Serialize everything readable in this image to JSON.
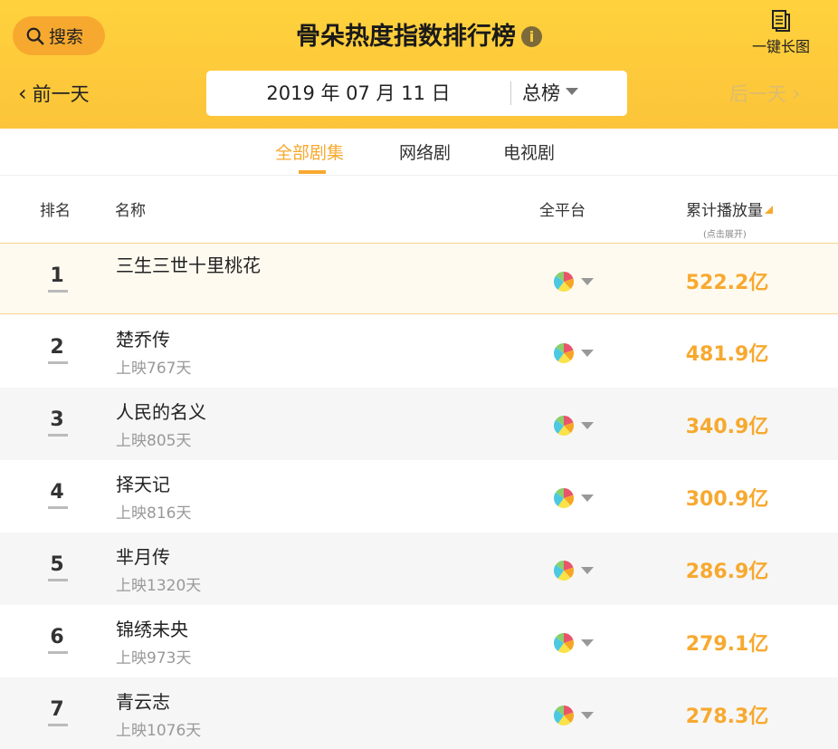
{
  "header": {
    "search_label": "搜索",
    "title": "骨朵热度指数排行榜",
    "info_glyph": "i",
    "long_image_label": "一键长图",
    "prev_day": "前一天",
    "next_day": "后一天",
    "date": "2019 年 07 月 11 日",
    "board": "总榜"
  },
  "tabs": [
    {
      "label": "全部剧集",
      "active": true
    },
    {
      "label": "网络剧",
      "active": false
    },
    {
      "label": "电视剧",
      "active": false
    }
  ],
  "columns": {
    "rank": "排名",
    "name": "名称",
    "platform": "全平台",
    "plays": "累计播放量",
    "plays_hint": "(点击展开)"
  },
  "rows": [
    {
      "rank": "1",
      "name": "三生三世十里桃花",
      "days": "",
      "value": "522.2亿"
    },
    {
      "rank": "2",
      "name": "楚乔传",
      "days": "上映767天",
      "value": "481.9亿"
    },
    {
      "rank": "3",
      "name": "人民的名义",
      "days": "上映805天",
      "value": "340.9亿"
    },
    {
      "rank": "4",
      "name": "择天记",
      "days": "上映816天",
      "value": "300.9亿"
    },
    {
      "rank": "5",
      "name": "芈月传",
      "days": "上映1320天",
      "value": "286.9亿"
    },
    {
      "rank": "6",
      "name": "锦绣未央",
      "days": "上映973天",
      "value": "279.1亿"
    },
    {
      "rank": "7",
      "name": "青云志",
      "days": "上映1076天",
      "value": "278.3亿"
    }
  ],
  "colors": {
    "header_bg": "#fcc43a",
    "accent": "#f7a92f",
    "pie_slices": [
      "#e9546b",
      "#f6a623",
      "#f9e24a",
      "#4cc9e0",
      "#8ad06a"
    ]
  },
  "icons": {
    "search": "search-icon",
    "info": "info-icon",
    "long_image": "document-icon",
    "prev": "chevron-left-icon",
    "next": "chevron-right-icon",
    "dropdown": "caret-down-icon",
    "platform": "pie-chart-icon"
  }
}
